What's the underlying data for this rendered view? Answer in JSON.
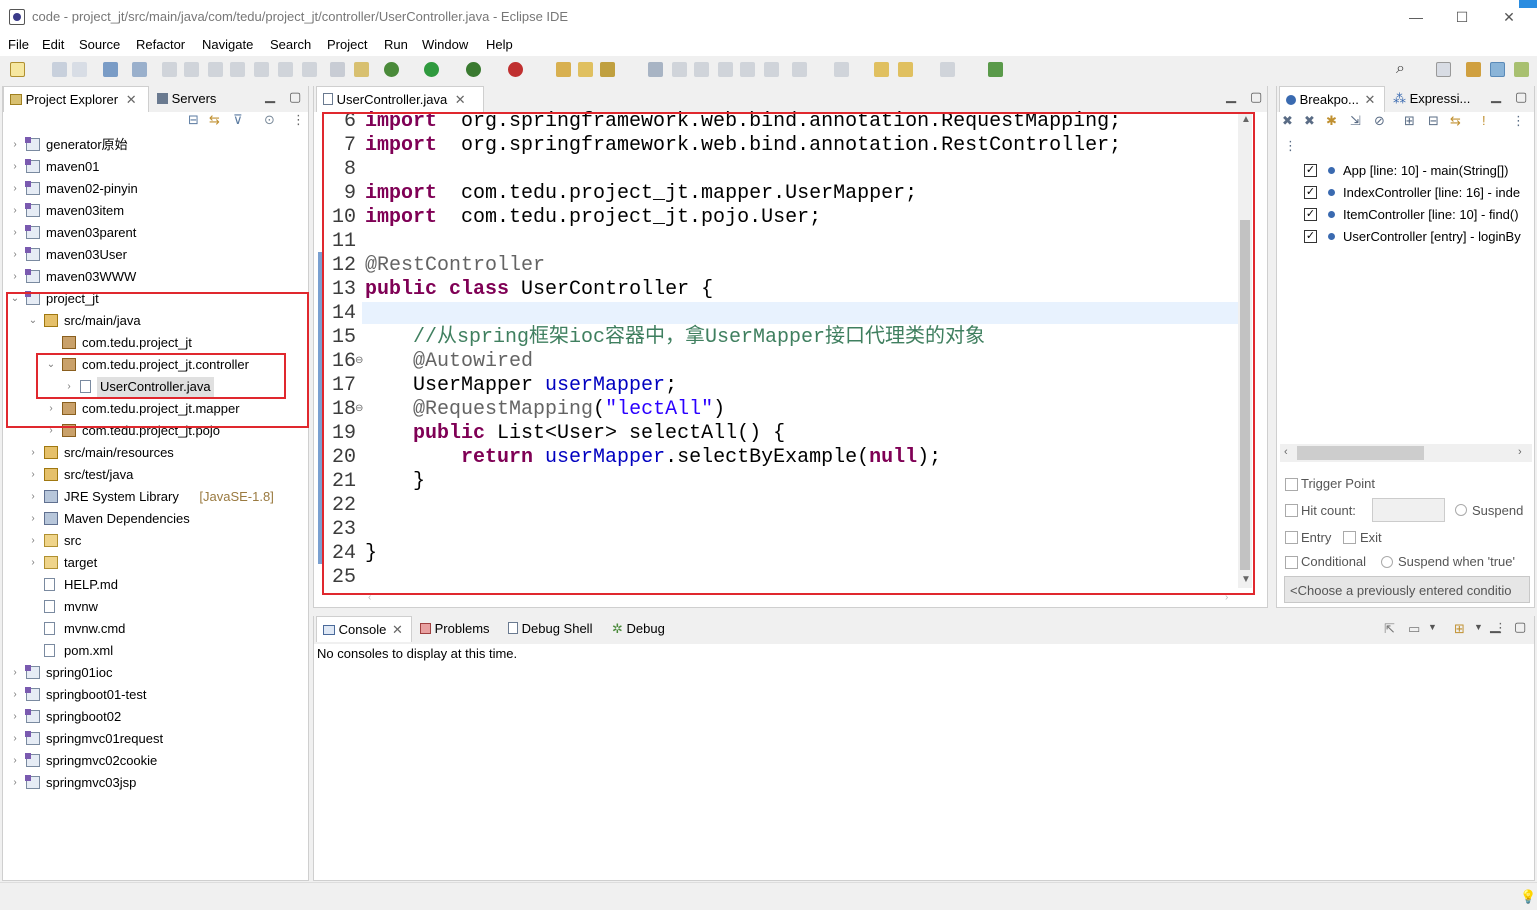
{
  "window": {
    "title": "code - project_jt/src/main/java/com/tedu/project_jt/controller/UserController.java - Eclipse IDE",
    "minimize": "—",
    "maximize": "☐",
    "close": "✕"
  },
  "menu": [
    "File",
    "Edit",
    "Source",
    "Refactor",
    "Navigate",
    "Search",
    "Project",
    "Run",
    "Window",
    "Help"
  ],
  "explorer": {
    "tab_project": "Project Explorer",
    "tab_servers": "Servers",
    "items": [
      {
        "label": "generator原始",
        "icon": "project-icon",
        "chev": "›"
      },
      {
        "label": "maven01",
        "icon": "project-icon",
        "chev": "›"
      },
      {
        "label": "maven02-pinyin",
        "icon": "project-icon",
        "chev": "›"
      },
      {
        "label": "maven03item",
        "icon": "project-icon",
        "chev": "›"
      },
      {
        "label": "maven03parent",
        "icon": "project-icon",
        "chev": "›"
      },
      {
        "label": "maven03User",
        "icon": "project-icon",
        "chev": "›"
      },
      {
        "label": "maven03WWW",
        "icon": "project-icon",
        "chev": "›"
      },
      {
        "label": "project_jt",
        "icon": "project-icon",
        "chev": "⌄"
      },
      {
        "label": "src/main/java",
        "icon": "source-folder-icon",
        "chev": "⌄"
      },
      {
        "label": "com.tedu.project_jt",
        "icon": "package-icon",
        "chev": ""
      },
      {
        "label": "com.tedu.project_jt.controller",
        "icon": "package-icon",
        "chev": "⌄"
      },
      {
        "label": "UserController.java",
        "icon": "java-file-icon",
        "chev": "›"
      },
      {
        "label": "com.tedu.project_jt.mapper",
        "icon": "package-icon",
        "chev": "›"
      },
      {
        "label": "com.tedu.project_jt.pojo",
        "icon": "package-icon",
        "chev": "›"
      },
      {
        "label": "src/main/resources",
        "icon": "source-folder-icon",
        "chev": "›"
      },
      {
        "label": "src/test/java",
        "icon": "source-folder-icon",
        "chev": "›"
      },
      {
        "label": "JRE System Library",
        "icon": "library-icon",
        "chev": "›",
        "suffix": "[JavaSE-1.8]"
      },
      {
        "label": "Maven Dependencies",
        "icon": "library-icon",
        "chev": "›"
      },
      {
        "label": "src",
        "icon": "folder-icon",
        "chev": "›"
      },
      {
        "label": "target",
        "icon": "folder-icon",
        "chev": "›"
      },
      {
        "label": "HELP.md",
        "icon": "file-icon",
        "chev": ""
      },
      {
        "label": "mvnw",
        "icon": "file-icon",
        "chev": ""
      },
      {
        "label": "mvnw.cmd",
        "icon": "file-icon",
        "chev": ""
      },
      {
        "label": "pom.xml",
        "icon": "file-icon",
        "chev": ""
      },
      {
        "label": "spring01ioc",
        "icon": "project-icon",
        "chev": "›"
      },
      {
        "label": "springboot01-test",
        "icon": "project-icon",
        "chev": "›"
      },
      {
        "label": "springboot02",
        "icon": "project-icon",
        "chev": "›"
      },
      {
        "label": "springmvc01request",
        "icon": "project-icon",
        "chev": "›"
      },
      {
        "label": "springmvc02cookie",
        "icon": "project-icon",
        "chev": "›"
      },
      {
        "label": "springmvc03jsp",
        "icon": "project-icon",
        "chev": "›"
      }
    ]
  },
  "editor": {
    "tab_label": "UserController.java",
    "lines": [
      {
        "n": "6",
        "parts": [
          [
            "kw",
            "import"
          ],
          [
            "",
            "  org.springframework.web.bind.annotation.RequestMapping;"
          ]
        ]
      },
      {
        "n": "7",
        "parts": [
          [
            "kw",
            "import"
          ],
          [
            "",
            "  org.springframework.web.bind.annotation.RestController;"
          ]
        ]
      },
      {
        "n": "8",
        "parts": []
      },
      {
        "n": "9",
        "parts": [
          [
            "kw",
            "import"
          ],
          [
            "",
            "  com.tedu.project_jt.mapper.UserMapper;"
          ]
        ]
      },
      {
        "n": "10",
        "parts": [
          [
            "kw",
            "import"
          ],
          [
            "",
            "  com.tedu.project_jt.pojo.User;"
          ]
        ]
      },
      {
        "n": "11",
        "parts": []
      },
      {
        "n": "12",
        "parts": [
          [
            "an",
            "@RestController"
          ]
        ]
      },
      {
        "n": "13",
        "parts": [
          [
            "kw",
            "public"
          ],
          [
            "",
            " "
          ],
          [
            "kw",
            "class"
          ],
          [
            "",
            " UserController {"
          ]
        ]
      },
      {
        "n": "14",
        "parts": []
      },
      {
        "n": "15",
        "parts": [
          [
            "",
            "    "
          ],
          [
            "cm",
            "//从spring框架ioc容器中，拿UserMapper接口代理类的对象"
          ]
        ]
      },
      {
        "n": "16",
        "parts": [
          [
            "",
            "    "
          ],
          [
            "an",
            "@Autowired"
          ]
        ]
      },
      {
        "n": "17",
        "parts": [
          [
            "",
            "    UserMapper "
          ],
          [
            "fd",
            "userMapper"
          ],
          [
            "",
            ";"
          ]
        ]
      },
      {
        "n": "18",
        "parts": [
          [
            "",
            "    "
          ],
          [
            "an",
            "@RequestMapping"
          ],
          [
            "",
            "("
          ],
          [
            "st",
            "\"lectAll\""
          ],
          [
            "",
            ")"
          ]
        ]
      },
      {
        "n": "19",
        "parts": [
          [
            "",
            "    "
          ],
          [
            "kw",
            "public"
          ],
          [
            "",
            " List<User> selectAll() {"
          ]
        ]
      },
      {
        "n": "20",
        "parts": [
          [
            "",
            "        "
          ],
          [
            "kw",
            "return"
          ],
          [
            "",
            " "
          ],
          [
            "fd",
            "userMapper"
          ],
          [
            "",
            ".selectByExample("
          ],
          [
            "kw",
            "null"
          ],
          [
            "",
            ");"
          ]
        ]
      },
      {
        "n": "21",
        "parts": [
          [
            "",
            "    }"
          ]
        ]
      },
      {
        "n": "22",
        "parts": []
      },
      {
        "n": "23",
        "parts": []
      },
      {
        "n": "24",
        "parts": [
          [
            "",
            "}"
          ]
        ]
      },
      {
        "n": "25",
        "parts": []
      }
    ]
  },
  "breakpoints": {
    "tab_breakpoints": "Breakpo...",
    "tab_expressions": "Expressi...",
    "items": [
      "App [line: 10] - main(String[])",
      "IndexController [line: 16] - inde",
      "ItemController [line: 10] - find()",
      "UserController [entry] - loginBy"
    ],
    "trigger_point": "Trigger Point",
    "hit_count": "Hit count:",
    "suspend": "Suspend",
    "entry": "Entry",
    "exit": "Exit",
    "conditional": "Conditional",
    "suspend_when": "Suspend when 'true'",
    "condition_placeholder": "<Choose a previously entered conditio"
  },
  "console": {
    "tabs": [
      "Console",
      "Problems",
      "Debug Shell",
      "Debug"
    ],
    "message": "No consoles to display at this time."
  }
}
